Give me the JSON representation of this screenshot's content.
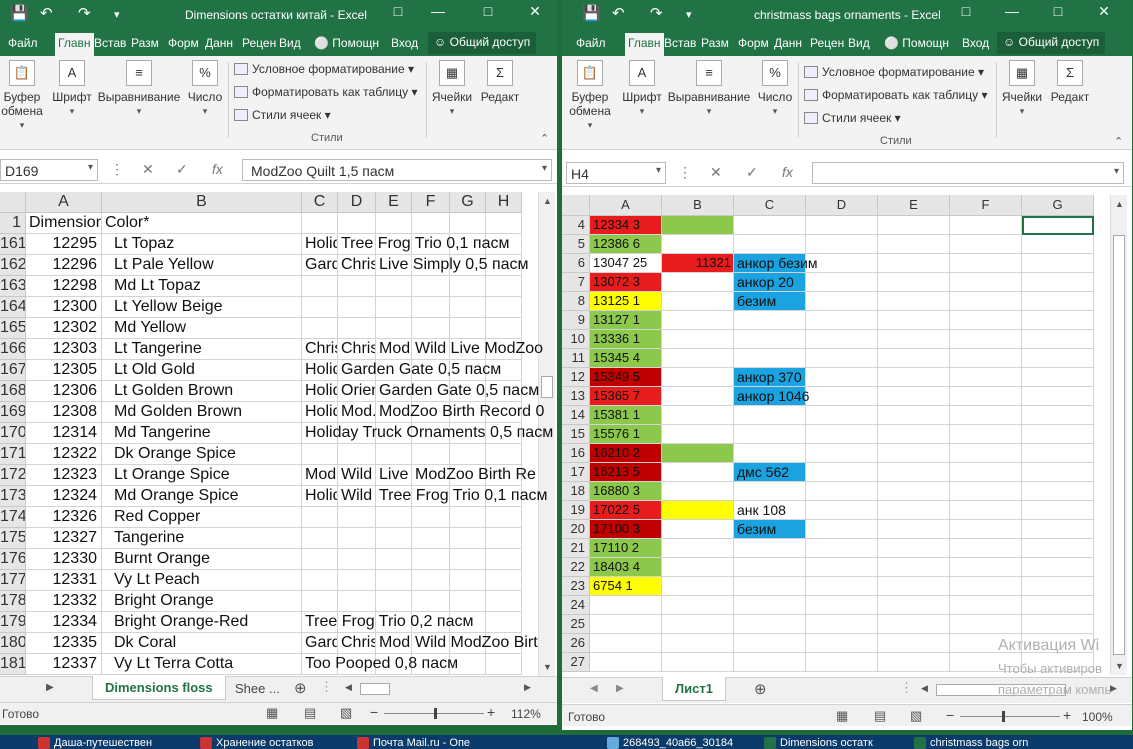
{
  "left_window": {
    "title": "Dimensions остатки китай - Excel",
    "menu": [
      "Файл",
      "Главн",
      "Встав",
      "Разм",
      "Форм",
      "Данн",
      "Рецен",
      "Вид"
    ],
    "tell_me": "Помощн",
    "signin": "Вход",
    "share": "Общий доступ",
    "ribbon": {
      "clipboard": "Буфер обмена",
      "font": "Шрифт",
      "alignment": "Выравнивание",
      "number": "Число",
      "cond_format": "Условное форматирование",
      "format_table": "Форматировать как таблицу",
      "cell_styles": "Стили ячеек",
      "styles_group": "Стили",
      "cells": "Ячейки",
      "editing": "Редакт"
    },
    "name_box": "D169",
    "formula": "ModZoo Quilt 1,5 пасм",
    "columns": [
      "A",
      "B",
      "C",
      "D",
      "E",
      "F",
      "G",
      "H"
    ],
    "row1": {
      "num": "1",
      "a": "Dimension",
      "b": "Color*"
    },
    "rows": [
      {
        "num": "161",
        "a": "12295",
        "b": "Lt Topaz",
        "c": "Holid",
        "d": "Tree Frog Trio 0,1 пасм",
        "e": "",
        "f": ""
      },
      {
        "num": "162",
        "a": "12296",
        "b": "Lt Pale Yellow",
        "c": "Gard",
        "d": "Chris",
        "e": "Live Simply 0,5 пасм",
        "f": ""
      },
      {
        "num": "163",
        "a": "12298",
        "b": "Md Lt Topaz",
        "c": "",
        "d": "",
        "e": "",
        "f": ""
      },
      {
        "num": "164",
        "a": "12300",
        "b": "Lt Yellow Beige",
        "c": "",
        "d": "",
        "e": "",
        "f": ""
      },
      {
        "num": "165",
        "a": "12302",
        "b": "Md Yellow",
        "c": "",
        "d": "",
        "e": "",
        "f": ""
      },
      {
        "num": "166",
        "a": "12303",
        "b": "Lt Tangerine",
        "c": "Chris",
        "d": "Chris",
        "e": "Mod.",
        "f": "Wild  Live  ModZoo"
      },
      {
        "num": "167",
        "a": "12305",
        "b": "Lt Old Gold",
        "c": "Holid",
        "d": "Garden Gate 0,5 пасм",
        "e": "",
        "f": ""
      },
      {
        "num": "168",
        "a": "12306",
        "b": "Lt Golden Brown",
        "c": "Holid",
        "d": "Orien",
        "e": "Garden Gate 0,5 пасм",
        "f": ""
      },
      {
        "num": "169",
        "a": "12308",
        "b": "Md Golden Brown",
        "c": "Holid",
        "d": "Mod.",
        "e": "ModZoo Birth Record 0",
        "f": ""
      },
      {
        "num": "170",
        "a": "12314",
        "b": "Md Tangerine",
        "c": "Holiday Truck Ornaments 0,5 пасм",
        "d": "",
        "e": "",
        "f": ""
      },
      {
        "num": "171",
        "a": "12322",
        "b": "Dk Orange Spice",
        "c": "",
        "d": "",
        "e": "",
        "f": ""
      },
      {
        "num": "172",
        "a": "12323",
        "b": "Lt Orange Spice",
        "c": "Mod.",
        "d": "Wild",
        "e": "Live",
        "f": "ModZoo Birth Re"
      },
      {
        "num": "173",
        "a": "12324",
        "b": "Md Orange Spice",
        "c": "Holid",
        "d": "Wild",
        "e": "Tree Frog Trio 0,1 пасм",
        "f": ""
      },
      {
        "num": "174",
        "a": "12326",
        "b": "Red Copper",
        "c": "",
        "d": "",
        "e": "",
        "f": ""
      },
      {
        "num": "175",
        "a": "12327",
        "b": "Tangerine",
        "c": "",
        "d": "",
        "e": "",
        "f": ""
      },
      {
        "num": "176",
        "a": "12330",
        "b": "Burnt Orange",
        "c": "",
        "d": "",
        "e": "",
        "f": ""
      },
      {
        "num": "177",
        "a": "12331",
        "b": "Vy Lt Peach",
        "c": "",
        "d": "",
        "e": "",
        "f": ""
      },
      {
        "num": "178",
        "a": "12332",
        "b": "Bright Orange",
        "c": "",
        "d": "",
        "e": "",
        "f": ""
      },
      {
        "num": "179",
        "a": "12334",
        "b": "Bright Orange-Red",
        "c": "Tree Frog Trio 0,2 пасм",
        "d": "",
        "e": "",
        "f": ""
      },
      {
        "num": "180",
        "a": "12335",
        "b": "Dk Coral",
        "c": "Gard",
        "d": "Chris",
        "e": "Mod.",
        "f": "Wild  ModZoo Birt"
      },
      {
        "num": "181",
        "a": "12337",
        "b": "Vy Lt Terra Cotta",
        "c": "Too Pooped 0,8 пасм",
        "d": "",
        "e": "",
        "f": ""
      }
    ],
    "tabs": [
      "Dimensions floss",
      "Shee ..."
    ],
    "status": "Готово",
    "zoom": "112%"
  },
  "right_window": {
    "title": "christmass bags ornaments - Excel",
    "menu": [
      "Файл",
      "Главн",
      "Встав",
      "Разм",
      "Форм",
      "Данн",
      "Рецен",
      "Вид"
    ],
    "tell_me": "Помощн",
    "signin": "Вход",
    "share": "Общий доступ",
    "ribbon": {
      "clipboard": "Буфер обмена",
      "font": "Шрифт",
      "alignment": "Выравнивание",
      "number": "Число",
      "cond_format": "Условное форматирование",
      "format_table": "Форматировать как таблицу",
      "cell_styles": "Стили ячеек",
      "styles_group": "Стили",
      "cells": "Ячейки",
      "editing": "Редакт"
    },
    "name_box": "H4",
    "formula": "",
    "columns": [
      "A",
      "B",
      "C",
      "D",
      "E",
      "F",
      "G"
    ],
    "rows": [
      {
        "num": "4",
        "a": "12334 3",
        "a_bg": "#e81c1c",
        "b": "",
        "b_bg": "#8cc84b",
        "c": "",
        "c_bg": ""
      },
      {
        "num": "5",
        "a": "12386 6",
        "a_bg": "#8cc84b",
        "b": "",
        "b_bg": "",
        "c": "",
        "c_bg": ""
      },
      {
        "num": "6",
        "a": "13047 25",
        "a_bg": "",
        "b": "11321",
        "b_bg": "#e81c1c",
        "c": "анкор безим",
        "c_bg": "#1aa3e0"
      },
      {
        "num": "7",
        "a": "13072 3",
        "a_bg": "#e81c1c",
        "b": "",
        "b_bg": "",
        "c": "анкор 20",
        "c_bg": "#1aa3e0"
      },
      {
        "num": "8",
        "a": "13125 1",
        "a_bg": "#ffff00",
        "b": "",
        "b_bg": "",
        "c": "безим",
        "c_bg": "#1aa3e0"
      },
      {
        "num": "9",
        "a": "13127 1",
        "a_bg": "#8cc84b",
        "b": "",
        "b_bg": "",
        "c": "",
        "c_bg": ""
      },
      {
        "num": "10",
        "a": "13336 1",
        "a_bg": "#8cc84b",
        "b": "",
        "b_bg": "",
        "c": "",
        "c_bg": ""
      },
      {
        "num": "11",
        "a": "15345 4",
        "a_bg": "#8cc84b",
        "b": "",
        "b_bg": "",
        "c": "",
        "c_bg": ""
      },
      {
        "num": "12",
        "a": "15349 5",
        "a_bg": "#c00000",
        "b": "",
        "b_bg": "",
        "c": "анкор 370",
        "c_bg": "#1aa3e0"
      },
      {
        "num": "13",
        "a": "15365 7",
        "a_bg": "#e81c1c",
        "b": "",
        "b_bg": "",
        "c": "анкор 1046",
        "c_bg": "#1aa3e0"
      },
      {
        "num": "14",
        "a": "15381 1",
        "a_bg": "#8cc84b",
        "b": "",
        "b_bg": "",
        "c": "",
        "c_bg": ""
      },
      {
        "num": "15",
        "a": "15576 1",
        "a_bg": "#8cc84b",
        "b": "",
        "b_bg": "",
        "c": "",
        "c_bg": ""
      },
      {
        "num": "16",
        "a": "16210 2",
        "a_bg": "#c00000",
        "b": "",
        "b_bg": "#8cc84b",
        "c": "",
        "c_bg": ""
      },
      {
        "num": "17",
        "a": "16213 5",
        "a_bg": "#c00000",
        "b": "",
        "b_bg": "",
        "c": "дмс 562",
        "c_bg": "#1aa3e0"
      },
      {
        "num": "18",
        "a": "16880 3",
        "a_bg": "#8cc84b",
        "b": "",
        "b_bg": "",
        "c": "",
        "c_bg": ""
      },
      {
        "num": "19",
        "a": "17022 5",
        "a_bg": "#e81c1c",
        "b": "",
        "b_bg": "#ffff00",
        "c": "анк 108",
        "c_bg": ""
      },
      {
        "num": "20",
        "a": "17100 3",
        "a_bg": "#c00000",
        "b": "",
        "b_bg": "",
        "c": "безим",
        "c_bg": "#1aa3e0"
      },
      {
        "num": "21",
        "a": "17110 2",
        "a_bg": "#8cc84b",
        "b": "",
        "b_bg": "",
        "c": "",
        "c_bg": ""
      },
      {
        "num": "22",
        "a": "18403 4",
        "a_bg": "#8cc84b",
        "b": "",
        "b_bg": "",
        "c": "",
        "c_bg": ""
      },
      {
        "num": "23",
        "a": "6754 1",
        "a_bg": "#ffff00",
        "b": "",
        "b_bg": "",
        "c": "",
        "c_bg": ""
      },
      {
        "num": "24",
        "a": "",
        "a_bg": "",
        "b": "",
        "b_bg": "",
        "c": "",
        "c_bg": ""
      },
      {
        "num": "25",
        "a": "",
        "a_bg": "",
        "b": "",
        "b_bg": "",
        "c": "",
        "c_bg": ""
      },
      {
        "num": "26",
        "a": "",
        "a_bg": "",
        "b": "",
        "b_bg": "",
        "c": "",
        "c_bg": ""
      },
      {
        "num": "27",
        "a": "",
        "a_bg": "",
        "b": "",
        "b_bg": "",
        "c": "",
        "c_bg": ""
      }
    ],
    "tab": "Лист1",
    "status": "Готово",
    "zoom": "100%",
    "watermark_line1": "Активация Wi",
    "watermark_line2": "Чтобы активиров",
    "watermark_line3": "параметрам компь"
  },
  "taskbar": [
    "Даша-путешествен",
    "Хранение остатков",
    "Почта Mail.ru - Опе",
    "268493_40a66_30184",
    "Dimensions остатк",
    "christmass bags orn"
  ],
  "colors": {
    "excel_green": "#217346",
    "red": "#e81c1c",
    "dark_red": "#c00000",
    "green": "#8cc84b",
    "yellow": "#ffff00",
    "blue": "#1aa3e0"
  }
}
